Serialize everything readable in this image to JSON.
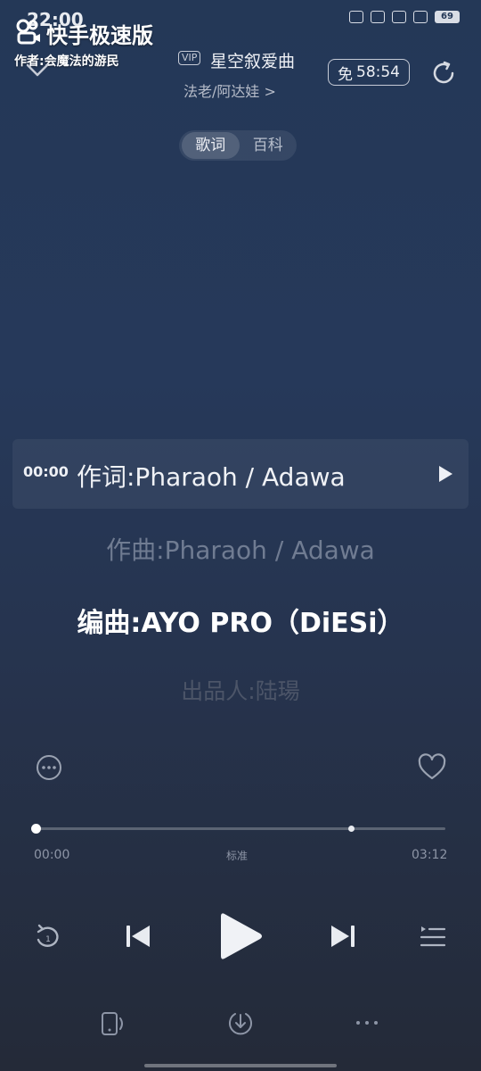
{
  "status_bar": {
    "time": "22:00",
    "battery": "69"
  },
  "watermark": {
    "app_name": "快手极速版",
    "author": "作者:会魔法的游民"
  },
  "header": {
    "vip_badge": "VIP",
    "song_title": "星空叙爱曲",
    "artist": "法老/阿达娃 >",
    "free_label": "免",
    "free_timer": "58:54"
  },
  "tabs": [
    {
      "label": "歌词",
      "active": true
    },
    {
      "label": "百科",
      "active": false
    }
  ],
  "lyrics": {
    "active_time": "00:00",
    "lines": [
      "作词:Pharaoh / Adawa",
      "作曲:Pharaoh / Adawa",
      "编曲:AYO PRO（DiESi）",
      "出品人:陆瑒"
    ]
  },
  "player": {
    "current_time": "00:00",
    "total_time": "03:12",
    "quality": "标准",
    "progress": 0.0,
    "buffered": 0.77
  },
  "icons": {
    "repeat": "repeat-one-icon",
    "prev": "previous-icon",
    "play": "play-icon",
    "next": "next-icon",
    "playlist": "playlist-icon",
    "more": "more-circle-icon",
    "heart": "heart-icon",
    "device": "device-icon",
    "download": "download-icon",
    "menu": "more-dots-icon"
  }
}
